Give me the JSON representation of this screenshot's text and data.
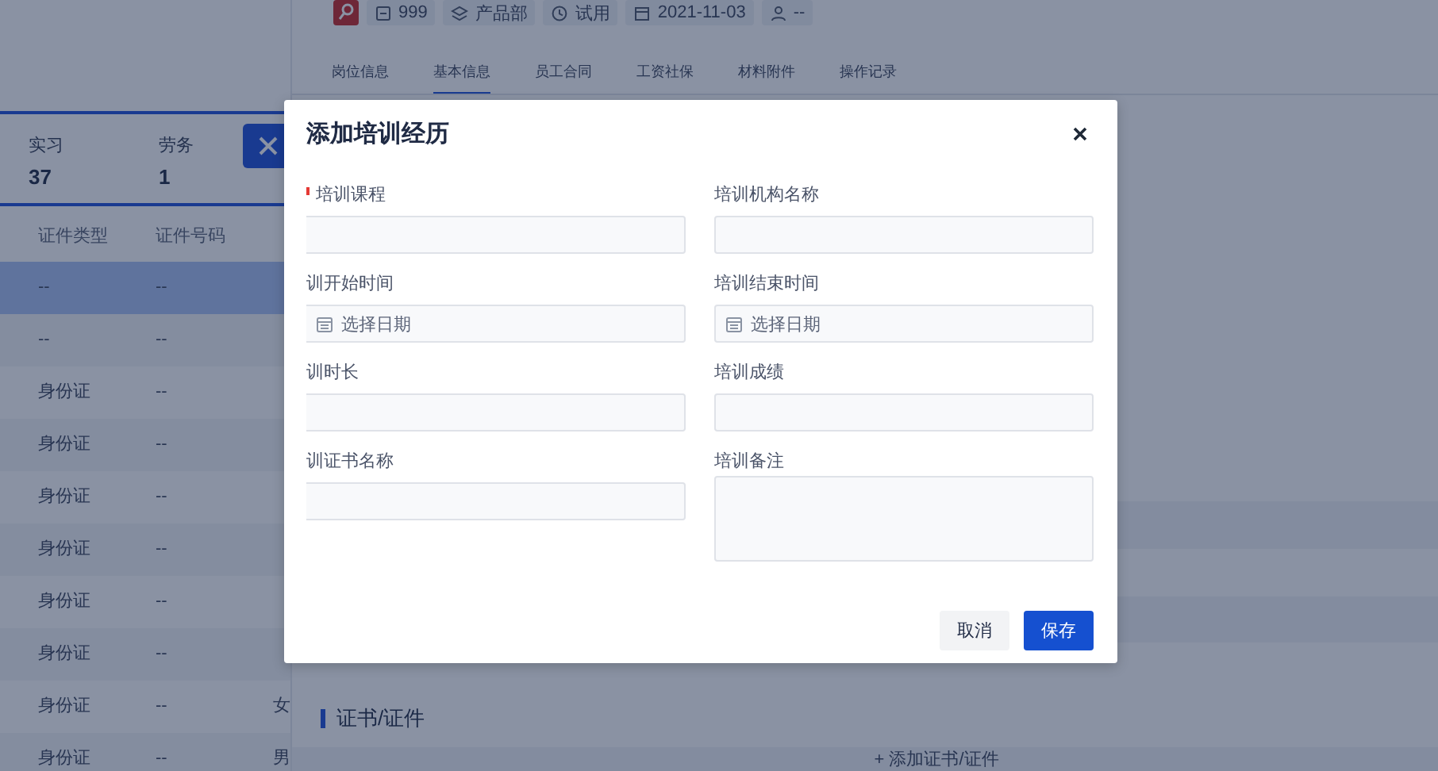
{
  "left_panel": {
    "stats": [
      {
        "label": "实习",
        "value": "37"
      },
      {
        "label": "劳务",
        "value": "1"
      }
    ],
    "table": {
      "columns": [
        "证件类型",
        "证件号码"
      ],
      "rows": [
        {
          "selected": true,
          "cells": [
            "--",
            "--"
          ]
        },
        {
          "selected": false,
          "cells": [
            "--",
            "--"
          ]
        },
        {
          "selected": false,
          "cells": [
            "身份证",
            "--"
          ]
        },
        {
          "selected": false,
          "cells": [
            "身份证",
            "--"
          ]
        },
        {
          "selected": false,
          "cells": [
            "身份证",
            "--"
          ]
        },
        {
          "selected": false,
          "cells": [
            "身份证",
            "--"
          ]
        },
        {
          "selected": false,
          "cells": [
            "身份证",
            "--"
          ]
        },
        {
          "selected": false,
          "cells": [
            "身份证",
            "--"
          ]
        },
        {
          "selected": false,
          "cells": [
            "身份证",
            "--",
            "女"
          ]
        },
        {
          "selected": false,
          "cells": [
            "身份证",
            "--",
            "男"
          ]
        }
      ]
    }
  },
  "employee": {
    "tags": [
      {
        "kind": "logo"
      },
      {
        "kind": "number",
        "text": "999"
      },
      {
        "kind": "department",
        "text": "产品部"
      },
      {
        "kind": "status",
        "text": "试用"
      },
      {
        "kind": "date",
        "text": "2021-11-03"
      },
      {
        "kind": "person",
        "text": "--"
      }
    ],
    "tabs": [
      {
        "label": "岗位信息",
        "selected": false
      },
      {
        "label": "基本信息",
        "selected": true
      },
      {
        "label": "员工合同",
        "selected": false
      },
      {
        "label": "工资社保",
        "selected": false
      },
      {
        "label": "材料附件",
        "selected": false
      },
      {
        "label": "操作记录",
        "selected": false
      }
    ],
    "section": {
      "title": "证书/证件",
      "add_button": "+ 添加证书/证件"
    }
  },
  "dialog": {
    "title": "添加培训经历",
    "fields": [
      {
        "label": "培训课程",
        "required": true,
        "kind": "input"
      },
      {
        "label": "培训机构名称",
        "required": false,
        "kind": "input"
      },
      {
        "label": "训开始时间",
        "required": false,
        "kind": "date",
        "placeholder": "选择日期"
      },
      {
        "label": "培训结束时间",
        "required": false,
        "kind": "date",
        "placeholder": "选择日期"
      },
      {
        "label": "训时长",
        "required": false,
        "kind": "input"
      },
      {
        "label": "培训成绩",
        "required": false,
        "kind": "input"
      },
      {
        "label": "训证书名称",
        "required": false,
        "kind": "input"
      },
      {
        "label": "培训备注",
        "required": false,
        "kind": "textarea"
      }
    ],
    "buttons": [
      {
        "label": "取消",
        "kind": "secondary"
      },
      {
        "label": "保存",
        "kind": "primary"
      }
    ]
  }
}
